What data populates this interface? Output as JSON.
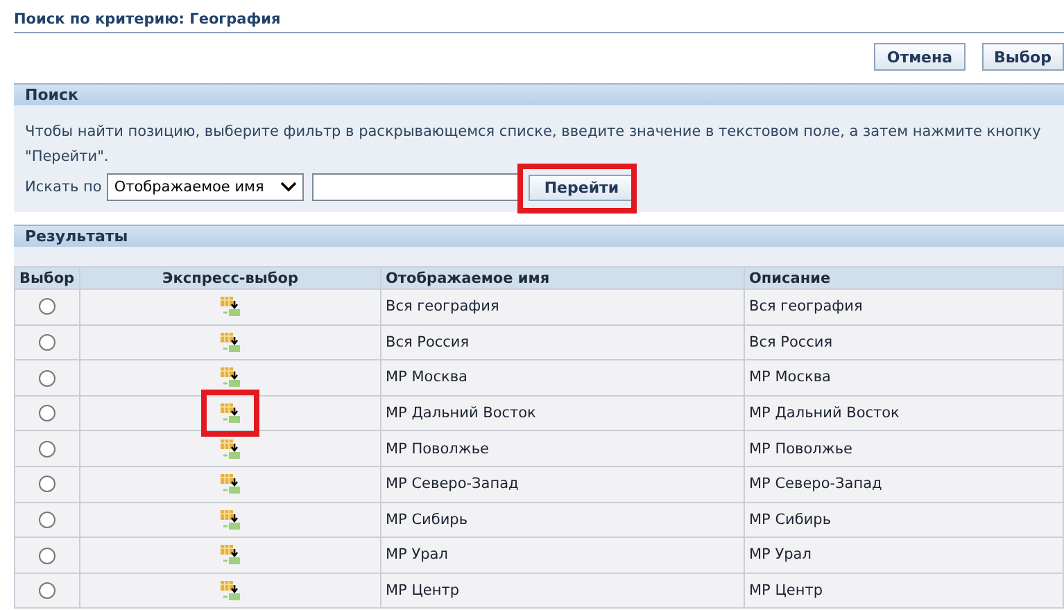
{
  "page_title": "Поиск по критерию: География",
  "buttons": [
    {
      "label": "Отмена"
    },
    {
      "label": "Выбор"
    }
  ],
  "search": {
    "heading": "Поиск",
    "instructions": "Чтобы найти позицию, выберите фильтр в раскрывающемся списке, введите значение в текстовом поле, а затем нажмите кнопку \"Перейти\".",
    "search_by_label": "Искать по",
    "filter": "Отображаемое имя",
    "go_button": "Перейти",
    "go_highlighted": true
  },
  "results": {
    "heading": "Результаты",
    "columns": [
      "Выбор",
      "Экспресс-выбор",
      "Отображаемое имя",
      "Описание"
    ],
    "rows": [
      {
        "name": "Вся география",
        "description": "Вся география",
        "selected": false,
        "highlighted": false
      },
      {
        "name": "Вся Россия",
        "description": "Вся Россия",
        "selected": false,
        "highlighted": false
      },
      {
        "name": "МР Москва",
        "description": "МР Москва",
        "selected": false,
        "highlighted": false
      },
      {
        "name": "МР Дальний Восток",
        "description": "МР Дальний Восток",
        "selected": false,
        "highlighted": true
      },
      {
        "name": "МР Поволжье",
        "description": "МР Поволжье",
        "selected": false,
        "highlighted": false
      },
      {
        "name": "МР Северо-Запад",
        "description": "МР Северо-Запад",
        "selected": false,
        "highlighted": false
      },
      {
        "name": "МР Сибирь",
        "description": "МР Сибирь",
        "selected": false,
        "highlighted": false
      },
      {
        "name": "МР Урал",
        "description": "МР Урал",
        "selected": false,
        "highlighted": false
      },
      {
        "name": "МР Центр",
        "description": "МР Центр",
        "selected": false,
        "highlighted": false
      }
    ]
  }
}
